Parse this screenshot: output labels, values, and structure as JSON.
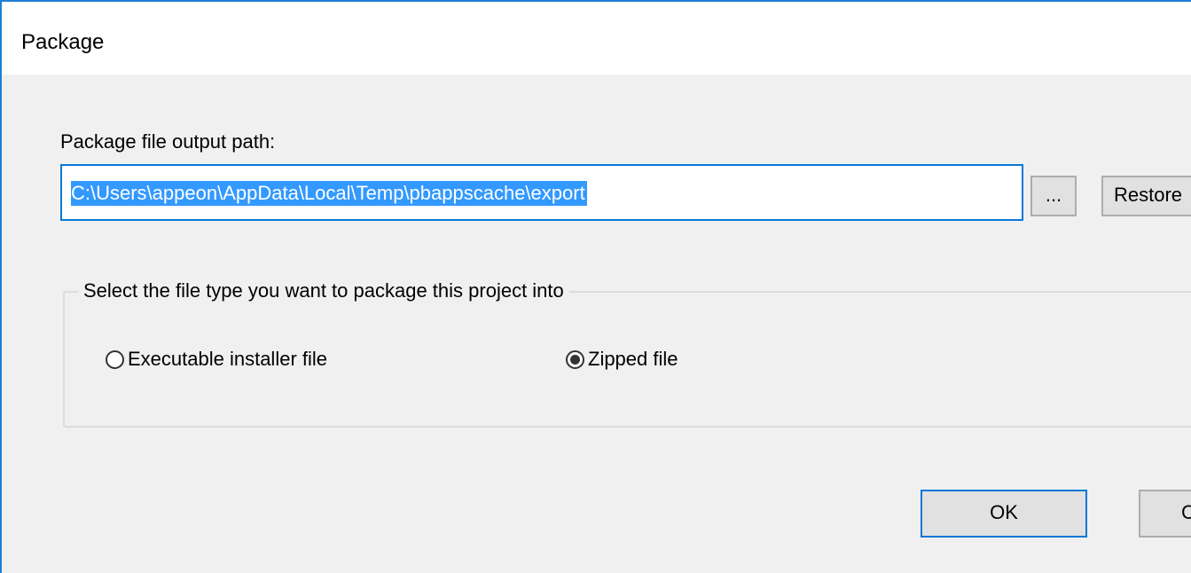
{
  "window": {
    "title": "Package"
  },
  "path": {
    "label": "Package file output path:",
    "value": "C:\\Users\\appeon\\AppData\\Local\\Temp\\pbappscache\\export",
    "browse_label": "...",
    "restore_label": "Restore"
  },
  "file_type": {
    "legend": "Select the file type you want to package this project into",
    "options": [
      {
        "label": "Executable installer file",
        "checked": false
      },
      {
        "label": "Zipped file",
        "checked": true
      }
    ]
  },
  "buttons": {
    "ok_label": "OK",
    "cancel_label": "C"
  },
  "colors": {
    "accent": "#0078d7",
    "selection": "#3399ff",
    "dialog_bg": "#f0f0f0"
  }
}
